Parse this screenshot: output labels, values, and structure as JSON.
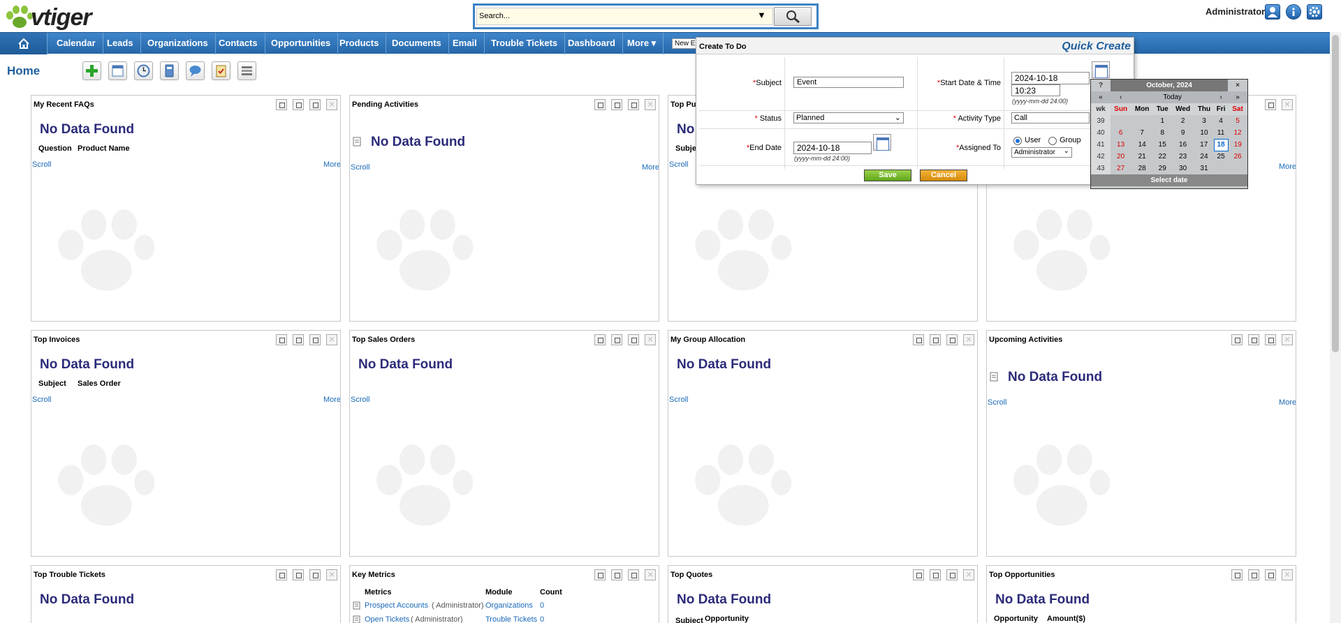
{
  "app": {
    "logo_text": "vtiger"
  },
  "search": {
    "value": "Search..."
  },
  "header": {
    "user": "Administrator"
  },
  "nav": {
    "items": [
      "Calendar",
      "Leads",
      "Organizations",
      "Contacts",
      "Opportunities",
      "Products",
      "Documents",
      "Email",
      "Trouble Tickets",
      "Dashboard",
      "More ▾"
    ],
    "new_event_label": "New E"
  },
  "home": {
    "title": "Home"
  },
  "panels": [
    {
      "title": "My Recent FAQs",
      "nodata": "No Data Found",
      "cols": [
        "Question",
        "Product Name"
      ],
      "scroll": "Scroll",
      "more": "More"
    },
    {
      "title": "Pending Activities",
      "nodata": "No Data Found",
      "scroll": "Scroll",
      "more": "More"
    },
    {
      "title": "Top Pu",
      "nodata": "No",
      "cols": [
        "Subje"
      ],
      "scroll": "Scroll"
    },
    {
      "title": "",
      "more": "More"
    },
    {
      "title": "Top Invoices",
      "nodata": "No Data Found",
      "cols": [
        "Subject",
        "Sales Order"
      ],
      "scroll": "Scroll",
      "more": "More"
    },
    {
      "title": "Top Sales Orders",
      "nodata": "No Data Found",
      "scroll": "Scroll"
    },
    {
      "title": "My Group Allocation",
      "nodata": "No Data Found",
      "scroll": "Scroll"
    },
    {
      "title": "Upcoming Activities",
      "nodata": "No Data Found",
      "scroll": "Scroll",
      "more": "More"
    },
    {
      "title": "Top Trouble Tickets",
      "nodata": "No Data Found"
    },
    {
      "title": "Key Metrics",
      "cols": [
        "Metrics",
        "Module",
        "Count"
      ],
      "rows": [
        {
          "metric": "Prospect Accounts",
          "owner": "( Administrator)",
          "module": "Organizations",
          "count": "0"
        },
        {
          "metric": "Open Tickets",
          "owner": "( Administrator)",
          "module": "Trouble Tickets",
          "count": "0"
        }
      ]
    },
    {
      "title": "Top Quotes",
      "nodata": "No Data Found",
      "cols": [
        "Subject",
        "Opportunity"
      ]
    },
    {
      "title": "Top Opportunities",
      "nodata": "No Data Found",
      "cols": [
        "Opportunity",
        "Amount($)"
      ]
    }
  ],
  "quick_create": {
    "title": "Create To Do",
    "brand": "Quick Create",
    "subject_label": "Subject",
    "subject_value": "Event",
    "start_label": "Start Date & Time",
    "start_date": "2024-10-18",
    "start_time": "10:23",
    "date_hint": "(yyyy-mm-dd 24:00)",
    "status_label": "Status",
    "status_value": "Planned",
    "activity_label": "Activity Type",
    "activity_value": "Call",
    "end_label": "End Date",
    "end_date": "2024-10-18",
    "assigned_label": "Assigned To",
    "user_label": "User",
    "group_label": "Group",
    "assigned_value": "Administrator",
    "save": "Save",
    "cancel": "Cancel"
  },
  "calendar": {
    "help": "?",
    "month": "October, 2024",
    "close": "×",
    "prev_year": "«",
    "prev_month": "‹",
    "today": "Today",
    "next_month": "›",
    "next_year": "»",
    "dow": [
      "wk",
      "Sun",
      "Mon",
      "Tue",
      "Wed",
      "Thu",
      "Fri",
      "Sat"
    ],
    "weeks": [
      [
        "39",
        "",
        "",
        "1",
        "2",
        "3",
        "4",
        "5"
      ],
      [
        "40",
        "6",
        "7",
        "8",
        "9",
        "10",
        "11",
        "12"
      ],
      [
        "41",
        "13",
        "14",
        "15",
        "16",
        "17",
        "18",
        "19"
      ],
      [
        "42",
        "20",
        "21",
        "22",
        "23",
        "24",
        "25",
        "26"
      ],
      [
        "43",
        "27",
        "28",
        "29",
        "30",
        "31",
        "",
        ""
      ]
    ],
    "selected_day": "18",
    "footer": "Select date"
  }
}
